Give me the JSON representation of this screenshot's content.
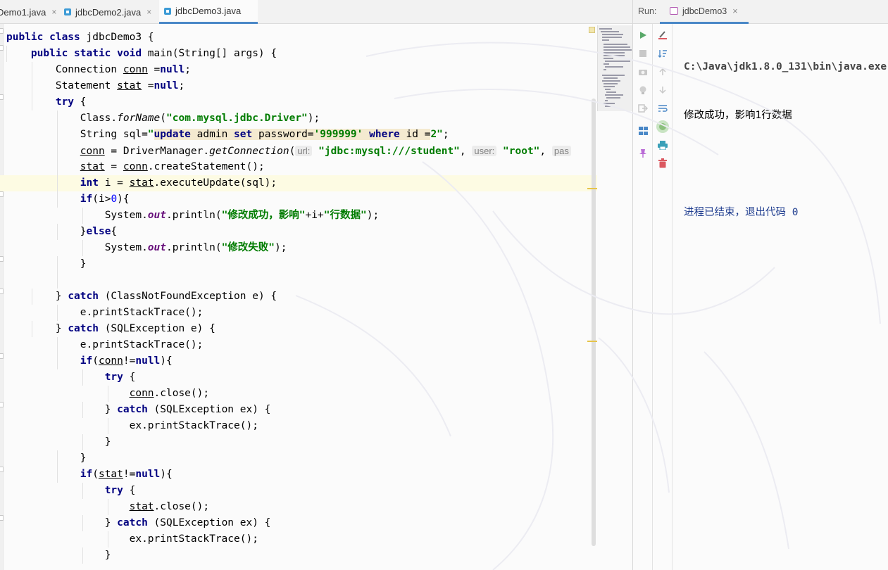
{
  "editor": {
    "tabs": [
      {
        "label": "Demo1.java",
        "active": false
      },
      {
        "label": "jdbcDemo2.java",
        "active": false
      },
      {
        "label": "jdbcDemo3.java",
        "active": true
      }
    ],
    "tab_close": "×"
  },
  "code": {
    "l1": {
      "kw1": "public class",
      "t1": " jdbcDemo3 {"
    },
    "l2": {
      "kw1": "public static void",
      "t1": " main(String[] args) {"
    },
    "l3": {
      "t1": "Connection ",
      "u1": "conn",
      "t2": " =",
      "kw1": "null",
      "t3": ";"
    },
    "l4": {
      "t1": "Statement ",
      "u1": "stat",
      "t2": " =",
      "kw1": "null",
      "t3": ";"
    },
    "l5": {
      "kw1": "try",
      "t1": " {"
    },
    "l6": {
      "t1": "Class.",
      "i1": "forName",
      "t2": "(",
      "s1": "\"com.mysql.jdbc.Driver\"",
      "t3": ");"
    },
    "l7": {
      "t1": "String sql=",
      "s1": "\"",
      "k1": "update",
      "q1": " admin ",
      "k2": "set",
      "q2": " password=",
      "s2": "'999999'",
      "q3": " ",
      "k3": "where",
      "q4": " id =",
      "s3": "2\"",
      "t2": ";"
    },
    "l8": {
      "u1": "conn",
      "t1": " = DriverManager.",
      "i1": "getConnection",
      "t2": "(",
      "h1": "url:",
      "t3": " ",
      "s1": "\"jdbc:mysql:///student\"",
      "t4": ", ",
      "h2": "user:",
      "t5": " ",
      "s2": "\"root\"",
      "t6": ", ",
      "h3": "pas"
    },
    "l9": {
      "u1": "stat",
      "t1": " = ",
      "u2": "conn",
      "t2": ".createStatement();"
    },
    "l10": {
      "kw1": "int",
      "t1": " i = ",
      "u1": "stat",
      "t2": ".executeUpdate(sql);"
    },
    "l11": {
      "kw1": "if",
      "t1": "(i>",
      "n1": "0",
      "t2": "){"
    },
    "l12": {
      "t1": "System.",
      "f1": "out",
      "t2": ".println(",
      "s1": "\"修改成功，影响\"",
      "t3": "+i+",
      "s2": "\"行数据\"",
      "t4": ");"
    },
    "l13": {
      "t1": "}",
      "kw1": "else",
      "t2": "{"
    },
    "l14": {
      "t1": "System.",
      "f1": "out",
      "t2": ".println(",
      "s1": "\"修改失败\"",
      "t3": ");"
    },
    "l15": {
      "t1": "}"
    },
    "l17": {
      "t1": "} ",
      "kw1": "catch",
      "t2": " (ClassNotFoundException e) {"
    },
    "l18": {
      "t1": "e.printStackTrace();"
    },
    "l19": {
      "t1": "} ",
      "kw1": "catch",
      "t2": " (SQLException e) {"
    },
    "l20": {
      "t1": "e.printStackTrace();"
    },
    "l21": {
      "kw1": "if",
      "t1": "(",
      "u1": "conn",
      "t2": "!=",
      "kw2": "null",
      "t3": "){"
    },
    "l22": {
      "kw1": "try",
      "t1": " {"
    },
    "l23": {
      "u1": "conn",
      "t1": ".close();"
    },
    "l24": {
      "t1": "} ",
      "kw1": "catch",
      "t2": " (SQLException ex) {"
    },
    "l25": {
      "t1": "ex.printStackTrace();"
    },
    "l26": {
      "t1": "}"
    },
    "l27": {
      "t1": "}"
    },
    "l28": {
      "kw1": "if",
      "t1": "(",
      "u1": "stat",
      "t2": "!=",
      "kw2": "null",
      "t3": "){"
    },
    "l29": {
      "kw1": "try",
      "t1": " {"
    },
    "l30": {
      "u1": "stat",
      "t1": ".close();"
    },
    "l31": {
      "t1": "} ",
      "kw1": "catch",
      "t2": " (SQLException ex) {"
    },
    "l32": {
      "t1": "ex.printStackTrace();"
    },
    "l33": {
      "t1": "}"
    }
  },
  "run": {
    "label": "Run:",
    "tab_label": "jdbcDemo3",
    "tab_close": "×",
    "console": {
      "cmd": "C:\\Java\\jdk1.8.0_131\\bin\\java.exe",
      "output": "修改成功，影响1行数据",
      "exit": "进程已结束，退出代码 0"
    }
  },
  "colors": {
    "keyword": "#000080",
    "string": "#007c00",
    "number": "#0000ff",
    "accent": "#4a88c7",
    "run_green": "#59a869",
    "stop_red": "#db5860"
  }
}
